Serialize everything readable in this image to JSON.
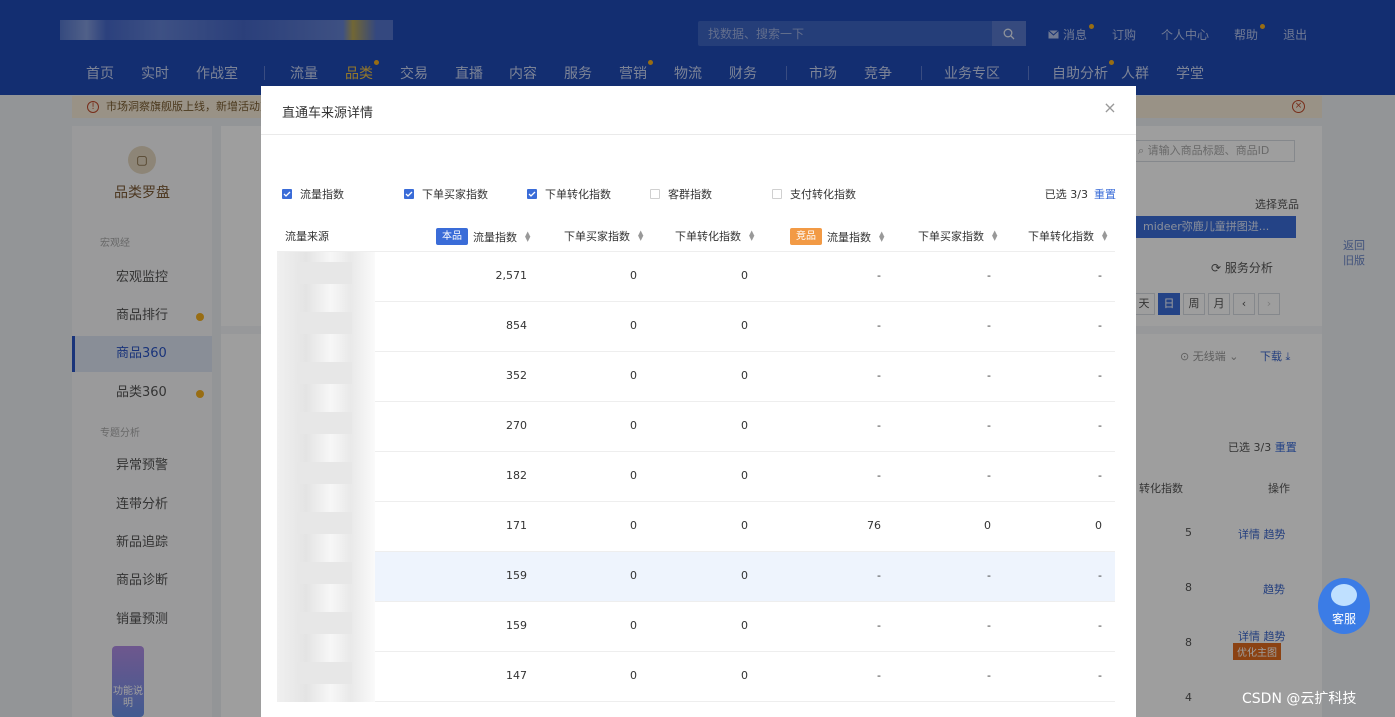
{
  "header": {
    "search_placeholder": "找数据、搜索一下",
    "top_links": [
      {
        "label": "消息",
        "dot": true
      },
      {
        "label": "订购",
        "dot": false
      },
      {
        "label": "个人中心",
        "dot": false
      },
      {
        "label": "帮助",
        "dot": true
      },
      {
        "label": "退出",
        "dot": false
      }
    ],
    "nav": [
      {
        "label": "首页"
      },
      {
        "label": "实时"
      },
      {
        "label": "作战室"
      },
      {
        "label": "流量"
      },
      {
        "label": "品类"
      },
      {
        "label": "交易"
      },
      {
        "label": "直播"
      },
      {
        "label": "内容"
      },
      {
        "label": "服务"
      },
      {
        "label": "营销"
      },
      {
        "label": "物流"
      },
      {
        "label": "财务"
      },
      {
        "label": "市场"
      },
      {
        "label": "竞争"
      },
      {
        "label": "业务专区"
      },
      {
        "label": "自助分析"
      },
      {
        "label": "人群"
      },
      {
        "label": "学堂"
      }
    ]
  },
  "notice": {
    "text": "市场洞察旗舰版上线，新增活动对"
  },
  "sidebar": {
    "title": "品类罗盘",
    "section1": "宏观经",
    "section2": "专题分析",
    "items": [
      {
        "label": "宏观监控"
      },
      {
        "label": "商品排行"
      },
      {
        "label": "商品360"
      },
      {
        "label": "品类360"
      },
      {
        "label": "异常预警"
      },
      {
        "label": "连带分析"
      },
      {
        "label": "新品追踪"
      },
      {
        "label": "商品诊断"
      },
      {
        "label": "销量预测"
      }
    ],
    "mascot_label": "功能说明"
  },
  "background": {
    "search_placeholder": "请输入商品标题、商品ID",
    "choose_product": "选择竞品",
    "product_chip": "mideer弥鹿儿童拼图进...",
    "service_analysis": "服务分析",
    "date_tabs": [
      "天",
      "日",
      "周",
      "月"
    ],
    "no_wireless": "无线端",
    "download": "下载",
    "selected": "已选 3/3",
    "reset": "重置",
    "col_rate": "转化指数",
    "col_op": "操作",
    "rows": [
      {
        "num": "5",
        "links": "详情 趋势",
        "tag": ""
      },
      {
        "num": "8",
        "links": "趋势",
        "tag": ""
      },
      {
        "num": "8",
        "links": "详情 趋势",
        "tag": "优化主图"
      },
      {
        "num": "4",
        "links": "",
        "tag": ""
      }
    ],
    "back_old": "返回旧版",
    "kefu": "客服"
  },
  "modal": {
    "title": "直通车来源详情",
    "close": "×",
    "checkboxes": [
      {
        "label": "流量指数",
        "checked": true
      },
      {
        "label": "下单买家指数",
        "checked": true
      },
      {
        "label": "下单转化指数",
        "checked": true
      },
      {
        "label": "客群指数",
        "checked": false
      },
      {
        "label": "支付转化指数",
        "checked": false
      }
    ],
    "selected_count": "已选 3/3",
    "reset": "重置",
    "columns": {
      "source": "流量来源",
      "own_tag": "本品",
      "comp_tag": "竞品",
      "own": [
        "流量指数",
        "下单买家指数",
        "下单转化指数"
      ],
      "comp": [
        "流量指数",
        "下单买家指数",
        "下单转化指数"
      ]
    },
    "rows": [
      {
        "own_flow": "2,571",
        "own_buyers": "0",
        "own_conv": "0",
        "comp_flow": "-",
        "comp_buyers": "-",
        "comp_conv": "-"
      },
      {
        "own_flow": "854",
        "own_buyers": "0",
        "own_conv": "0",
        "comp_flow": "-",
        "comp_buyers": "-",
        "comp_conv": "-"
      },
      {
        "own_flow": "352",
        "own_buyers": "0",
        "own_conv": "0",
        "comp_flow": "-",
        "comp_buyers": "-",
        "comp_conv": "-"
      },
      {
        "own_flow": "270",
        "own_buyers": "0",
        "own_conv": "0",
        "comp_flow": "-",
        "comp_buyers": "-",
        "comp_conv": "-"
      },
      {
        "own_flow": "182",
        "own_buyers": "0",
        "own_conv": "0",
        "comp_flow": "-",
        "comp_buyers": "-",
        "comp_conv": "-"
      },
      {
        "own_flow": "171",
        "own_buyers": "0",
        "own_conv": "0",
        "comp_flow": "76",
        "comp_buyers": "0",
        "comp_conv": "0"
      },
      {
        "own_flow": "159",
        "own_buyers": "0",
        "own_conv": "0",
        "comp_flow": "-",
        "comp_buyers": "-",
        "comp_conv": "-"
      },
      {
        "own_flow": "159",
        "own_buyers": "0",
        "own_conv": "0",
        "comp_flow": "-",
        "comp_buyers": "-",
        "comp_conv": "-"
      },
      {
        "own_flow": "147",
        "own_buyers": "0",
        "own_conv": "0",
        "comp_flow": "-",
        "comp_buyers": "-",
        "comp_conv": "-"
      }
    ]
  },
  "watermark": "CSDN @云扩科技",
  "colors": {
    "header": "#1f4bb7",
    "accent": "#3a6cd8",
    "orange": "#f29a45"
  }
}
